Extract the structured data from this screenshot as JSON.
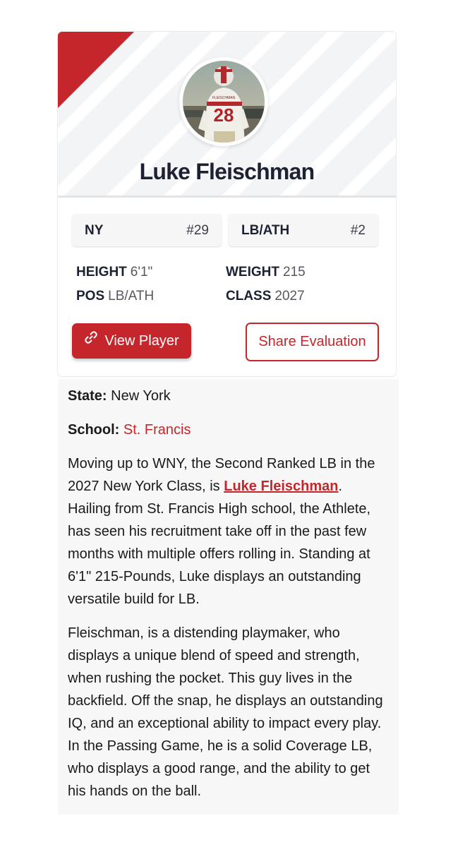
{
  "player": {
    "name": "Luke Fleischman",
    "photo_jersey_name": "FLEISCHMAN",
    "photo_jersey_number": "28"
  },
  "chips": [
    {
      "label": "NY",
      "value": "#29"
    },
    {
      "label": "LB/ATH",
      "value": "#2"
    }
  ],
  "stats": {
    "height": {
      "label": "HEIGHT",
      "value": "6'1\""
    },
    "weight": {
      "label": "WEIGHT",
      "value": "215"
    },
    "pos": {
      "label": "POS",
      "value": "LB/ATH"
    },
    "class": {
      "label": "CLASS",
      "value": "2027"
    }
  },
  "buttons": {
    "view_player": "View Player",
    "share_evaluation": "Share Evaluation"
  },
  "article": {
    "state_label": "State:",
    "state_value": "New York",
    "school_label": "School:",
    "school_value": "St. Francis",
    "p1_before": "Moving up to WNY, the Second Ranked LB in the 2027 New York Class, is ",
    "p1_link": "Luke Fleischman",
    "p1_after": ". Hailing from St. Francis High school, the Athlete, has seen his recruitment take off in the past few months with multiple offers rolling in. Standing at 6'1\" 215-Pounds, Luke displays an outstanding versatile build for LB.",
    "p2": "Fleischman, is a distending playmaker, who displays a unique blend of speed and strength, when rushing the pocket. This guy lives in the backfield. Off the snap, he displays an outstanding IQ, and an exceptional ability to impact every play. In the Passing Game, he is a solid Coverage LB, who displays a good range, and the ability to get his hands on the ball."
  },
  "colors": {
    "accent": "#c4262b",
    "text": "#1d2233",
    "article_bg": "#f7f7f7"
  }
}
